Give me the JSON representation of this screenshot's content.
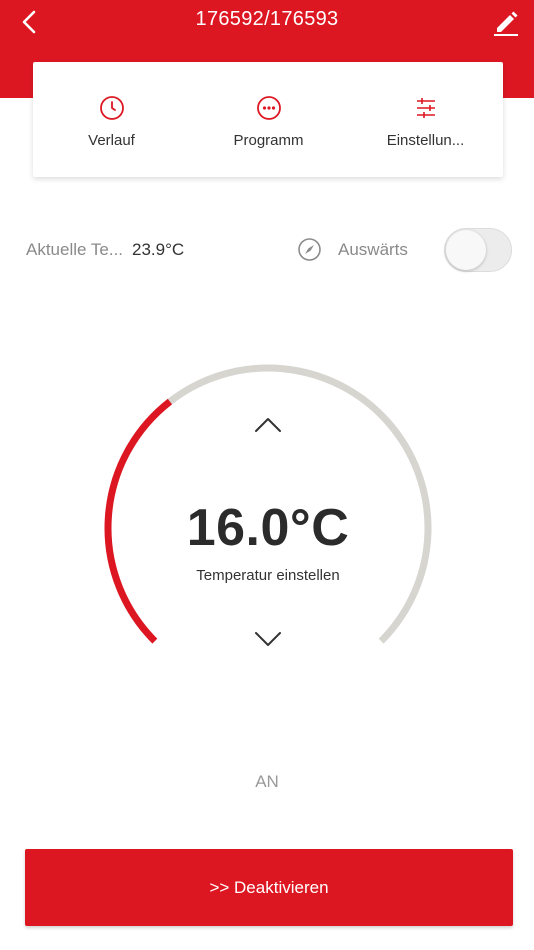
{
  "header": {
    "title": "176592/176593",
    "back_icon": "chevron-left-icon",
    "edit_icon": "pencil-icon"
  },
  "tabs": [
    {
      "label": "Verlauf",
      "icon": "clock-icon"
    },
    {
      "label": "Programm",
      "icon": "more-dots-icon"
    },
    {
      "label": "Einstellun...",
      "icon": "sliders-icon"
    }
  ],
  "status_row": {
    "current_label": "Aktuelle Te...",
    "current_value": "23.9°C",
    "away_label": "Auswärts",
    "away_icon": "compass-icon",
    "away_enabled": false
  },
  "thermostat": {
    "set_temperature": "16.0°C",
    "subtitle": "Temperatur einstellen",
    "up_icon": "chevron-up-icon",
    "down_icon": "chevron-down-icon",
    "dial_fill_fraction": 0.36
  },
  "mode_status": "AN",
  "deactivate_button": {
    "label": ">>  Deaktivieren"
  },
  "colors": {
    "accent": "#dd1722",
    "track": "#d6d5d0"
  }
}
